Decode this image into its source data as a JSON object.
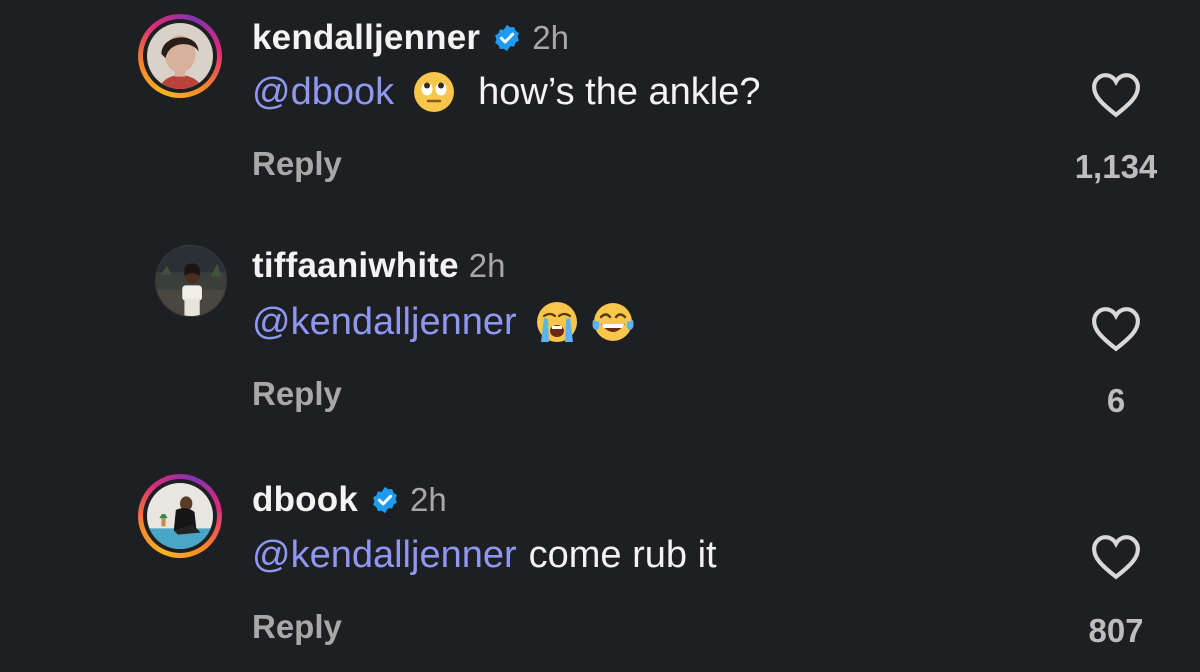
{
  "comments": [
    {
      "username": "kendalljenner",
      "verified": true,
      "time": "2h",
      "mention": "@dbook",
      "emojis": [
        "face-with-rolling-eyes"
      ],
      "text": "how’s the ankle?",
      "reply_label": "Reply",
      "likes": "1,134"
    },
    {
      "username": "tiffaaniwhite",
      "verified": false,
      "time": "2h",
      "mention": "@kendalljenner",
      "emojis": [
        "loudly-crying-face",
        "face-with-tears-of-joy"
      ],
      "text": "",
      "reply_label": "Reply",
      "likes": "6"
    },
    {
      "username": "dbook",
      "verified": true,
      "time": "2h",
      "mention": "@kendalljenner",
      "emojis": [],
      "text": "come rub it",
      "reply_label": "Reply",
      "likes": "807"
    }
  ],
  "colors": {
    "background": "#1d1f22",
    "mention": "#8e97f2",
    "verified": "#1d9bf0",
    "secondary_text": "#a8a8a8"
  }
}
